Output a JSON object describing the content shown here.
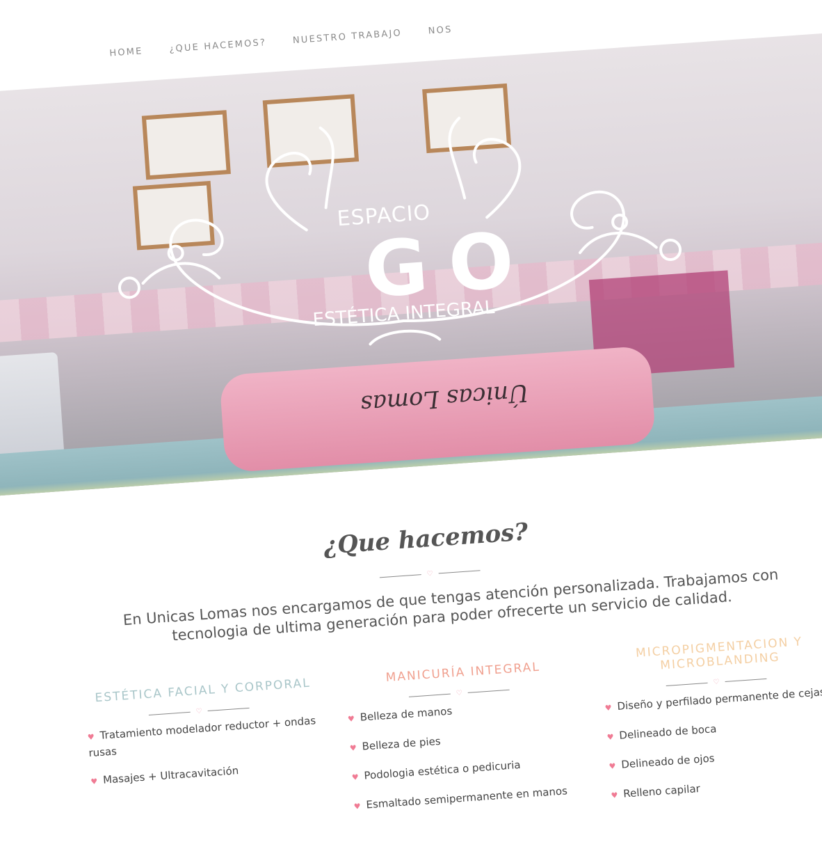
{
  "nav": {
    "items": [
      {
        "label": "HOME"
      },
      {
        "label": "¿QUE HACEMOS?"
      },
      {
        "label": "NUESTRO TRABAJO"
      },
      {
        "label": "NOS"
      }
    ]
  },
  "hero": {
    "logo": {
      "top_text": "ESPACIO",
      "main_text": "GO",
      "bottom_text": "ESTÉTICA INTEGRAL"
    },
    "pillow_text": "Únicas Lomas"
  },
  "section": {
    "title": "¿Que hacemos?",
    "intro": "En Unicas Lomas nos encargamos de que tengas atención personalizada. Trabajamos con tecnologia de ultima generación para poder ofrecerte un servicio de calidad."
  },
  "columns": [
    {
      "title": "ESTÉTICA FACIAL Y CORPORAL",
      "color": "#a9c6c9",
      "items": [
        "Tratamiento modelador reductor + ondas rusas",
        "Masajes + Ultracavitación"
      ]
    },
    {
      "title": "MANICURÍA INTEGRAL",
      "color": "#f0a08f",
      "items": [
        "Belleza de manos",
        "Belleza de pies",
        "Podologia estética o pedicuria",
        "Esmaltado semipermanente en manos"
      ]
    },
    {
      "title": "MICROPIGMENTACION Y MICROBLANDING",
      "color": "#f4cfa3",
      "items": [
        "Diseño y perfilado permanente de cejas",
        "Delineado de boca",
        "Delineado de ojos",
        "Relleno capilar"
      ]
    }
  ],
  "colors": {
    "accent_pink": "#f07b94",
    "heart": "#f0a2b3"
  }
}
